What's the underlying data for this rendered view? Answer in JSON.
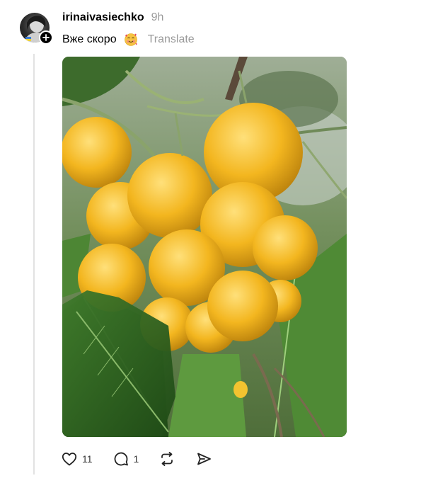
{
  "post": {
    "username": "irinaivasiechko",
    "time": "9h",
    "caption": "Вже скоро",
    "caption_emoji": "smiling-face-with-hearts-icon",
    "translate_label": "Translate"
  },
  "actions": {
    "likes": "11",
    "replies": "1"
  },
  "colors": {
    "timestamp_gray": "#9a9a9a",
    "thread_line": "#e2e2e2",
    "badge": "#000000"
  },
  "icons": [
    "plus-icon",
    "heart-icon",
    "comment-icon",
    "repost-icon",
    "share-icon"
  ]
}
